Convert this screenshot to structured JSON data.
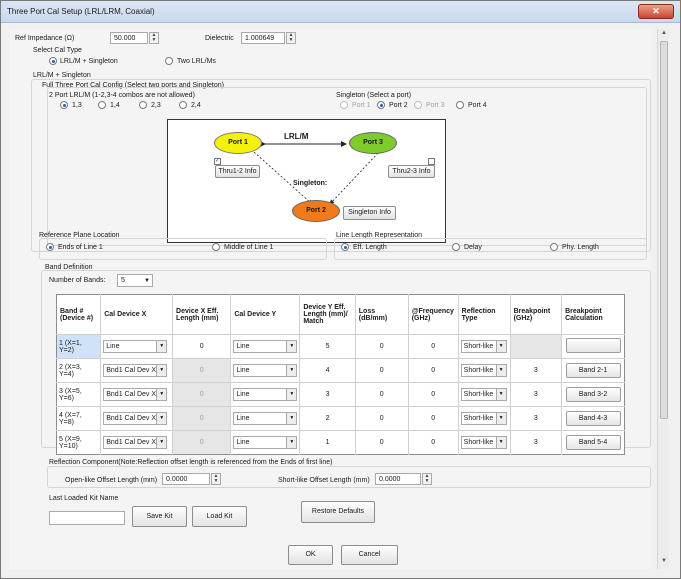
{
  "window": {
    "title": "Three Port Cal Setup (LRL/LRM, Coaxial)"
  },
  "top": {
    "ref_label": "Ref Impedance (Ω)",
    "ref_value": "50.000",
    "dielectric_label": "Dielectric",
    "dielectric_value": "1.000649",
    "cal_type_label": "Select Cal Type",
    "opt_lrl_singleton": "LRL/M + Singleton",
    "opt_two_lrl": "Two LRL/Ms"
  },
  "lrl": {
    "group_label": "LRL/M + Singleton",
    "full_label": "Full Three Port Cal Config (Select two ports and Singleton)",
    "two_port_label": "2 Port LRL/M (1-2,3-4 combos are not allowed)",
    "two_port_options": [
      "1,3",
      "1,4",
      "2,3",
      "2,4"
    ],
    "singleton_label": "Singleton (Select a port)",
    "singleton_options": [
      "Port 1",
      "Port 2",
      "Port 3",
      "Port 4"
    ]
  },
  "diagram": {
    "port1": "Port 1",
    "port2": "Port 2",
    "port3": "Port 3",
    "lrl_label": "LRL/M",
    "singleton_label": "Singleton:",
    "thru12": "Thru1-2 Info",
    "thru23": "Thru2-3 Info",
    "singleton_info": "Singleton Info"
  },
  "ref_plane": {
    "label": "Reference Plane Location",
    "opt1": "Ends of Line 1",
    "opt2": "Middle of Line 1"
  },
  "line_len": {
    "label": "Line Length Representation",
    "opt1": "Eff. Length",
    "opt2": "Delay",
    "opt3": "Phy. Length"
  },
  "band": {
    "label": "Band Definition",
    "num_label": "Number of Bands:",
    "num_value": "5",
    "columns": [
      "Band # (Device #)",
      "Cal Device X",
      "Device X Eff. Length (mm)",
      "Cal Device Y",
      "Device Y Eff. Length (mm)/ Match",
      "Loss (dB/mm)",
      "@Frequency (GHz)",
      "Reflection Type",
      "Breakpoint (GHz)",
      "Breakpoint Calculation"
    ],
    "rows": [
      {
        "band": "1 (X=1, Y=2)",
        "devx": "Line",
        "xlen": "0",
        "devy": "Line",
        "ylen": "5",
        "loss": "0",
        "freq": "0",
        "refl": "Short-like",
        "bp": "",
        "calc": ""
      },
      {
        "band": "2 (X=3, Y=4)",
        "devx": "Bnd1 Cal Dev X",
        "xlen": "0",
        "devy": "Line",
        "ylen": "4",
        "loss": "0",
        "freq": "0",
        "refl": "Short-like",
        "bp": "3",
        "calc": "Band 2-1"
      },
      {
        "band": "3 (X=5, Y=6)",
        "devx": "Bnd1 Cal Dev X",
        "xlen": "0",
        "devy": "Line",
        "ylen": "3",
        "loss": "0",
        "freq": "0",
        "refl": "Short-like",
        "bp": "3",
        "calc": "Band 3-2"
      },
      {
        "band": "4 (X=7, Y=8)",
        "devx": "Bnd1 Cal Dev X",
        "xlen": "0",
        "devy": "Line",
        "ylen": "2",
        "loss": "0",
        "freq": "0",
        "refl": "Short-like",
        "bp": "3",
        "calc": "Band 4-3"
      },
      {
        "band": "5 (X=9, Y=10)",
        "devx": "Bnd1 Cal Dev X",
        "xlen": "0",
        "devy": "Line",
        "ylen": "1",
        "loss": "0",
        "freq": "0",
        "refl": "Short-like",
        "bp": "3",
        "calc": "Band 5-4"
      }
    ]
  },
  "reflection": {
    "label": "Reflection Component(Note:Reflection offset length is referenced from the Ends of first line)",
    "open_label": "Open-like Offset Length (mm)",
    "open_value": "0.0000",
    "short_label": "Short-like Offset Length (mm)",
    "short_value": "0.0000"
  },
  "kit": {
    "label": "Last Loaded Kit Name",
    "value": "",
    "save": "Save Kit",
    "load": "Load Kit",
    "restore": "Restore Defaults"
  },
  "footer": {
    "ok": "OK",
    "cancel": "Cancel"
  }
}
